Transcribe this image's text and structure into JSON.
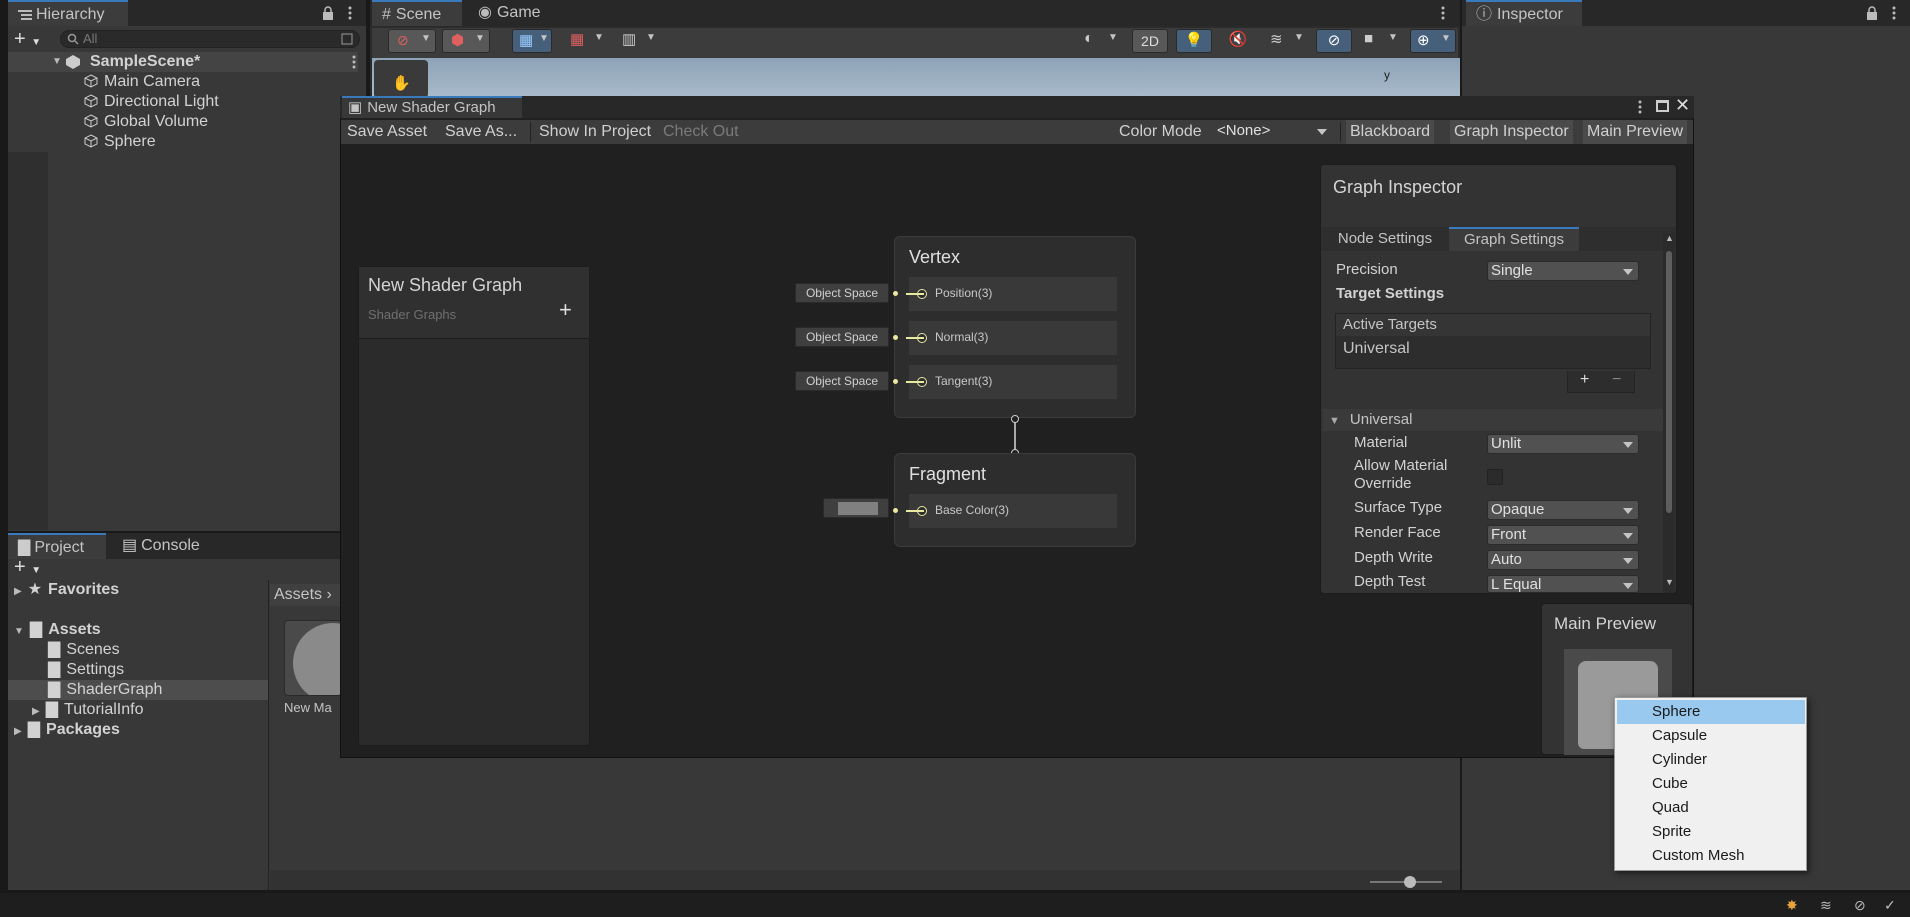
{
  "hierarchy": {
    "tab": "Hierarchy",
    "search_placeholder": "All",
    "scene": "SampleScene*",
    "items": [
      "Main Camera",
      "Directional Light",
      "Global Volume",
      "Sphere"
    ]
  },
  "scene_tabs": {
    "scene": "Scene",
    "game": "Game",
    "mode_2d": "2D",
    "axis_label": "y"
  },
  "inspector": {
    "tab": "Inspector"
  },
  "project": {
    "tabs": [
      "Project",
      "Console"
    ],
    "favorites": "Favorites",
    "assets": "Assets",
    "asset_children": [
      "Scenes",
      "Settings",
      "ShaderGraph",
      "TutorialInfo"
    ],
    "packages": "Packages",
    "breadcrumb": "Assets",
    "asset_tile_label": "New Ma"
  },
  "shader_graph": {
    "window_title": "New Shader Graph",
    "toolbar": {
      "save_asset": "Save Asset",
      "save_as": "Save As...",
      "show_in_project": "Show In Project",
      "check_out": "Check Out",
      "color_mode_label": "Color Mode",
      "color_mode_value": "<None>",
      "blackboard": "Blackboard",
      "graph_inspector": "Graph Inspector",
      "main_preview": "Main Preview"
    },
    "blackboard": {
      "title": "New Shader Graph",
      "subtitle": "Shader Graphs",
      "add": "+"
    },
    "vertex": {
      "title": "Vertex",
      "ports": [
        {
          "space": "Object Space",
          "name": "Position(3)"
        },
        {
          "space": "Object Space",
          "name": "Normal(3)"
        },
        {
          "space": "Object Space",
          "name": "Tangent(3)"
        }
      ]
    },
    "fragment": {
      "title": "Fragment",
      "ports": [
        {
          "name": "Base Color(3)"
        }
      ]
    },
    "graph_inspector": {
      "title": "Graph Inspector",
      "tabs": [
        "Node Settings",
        "Graph Settings"
      ],
      "precision_label": "Precision",
      "precision_value": "Single",
      "target_settings": "Target Settings",
      "active_targets": "Active Targets",
      "target_item": "Universal",
      "add": "+",
      "remove": "−",
      "section": "Universal",
      "fields": [
        {
          "label": "Material",
          "value": "Unlit"
        },
        {
          "label": "Allow Material Override",
          "value": ""
        },
        {
          "label": "Surface Type",
          "value": "Opaque"
        },
        {
          "label": "Render Face",
          "value": "Front"
        },
        {
          "label": "Depth Write",
          "value": "Auto"
        },
        {
          "label": "Depth Test",
          "value": "L Equal"
        }
      ]
    },
    "main_preview": {
      "title": "Main Preview"
    }
  },
  "preview_menu": {
    "items": [
      "Sphere",
      "Capsule",
      "Cylinder",
      "Cube",
      "Quad",
      "Sprite",
      "Custom Mesh"
    ],
    "selected": 0
  },
  "colors": {
    "accent": "#3a79bb",
    "menu_selected": "#99c9ef",
    "wire": "#e8e8a0",
    "graph_bg": "#202020"
  }
}
